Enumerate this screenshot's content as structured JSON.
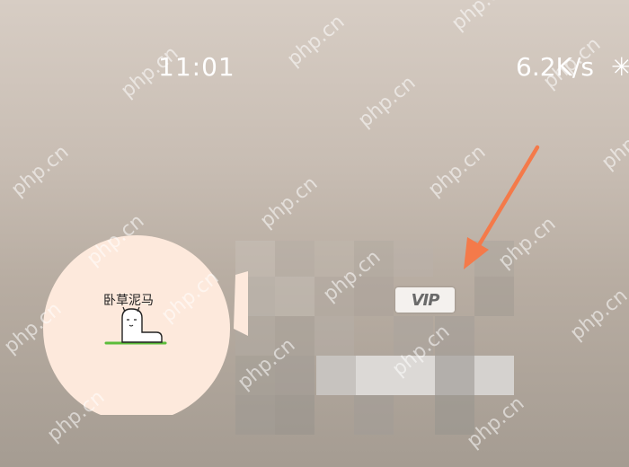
{
  "status_bar": {
    "time": "11:01",
    "network_speed": "6.2K/s",
    "partial_icon": "✳"
  },
  "avatar": {
    "caption": "卧草泥马",
    "icon": "cartoon-sticker-icon"
  },
  "badge": {
    "label": "VIP"
  },
  "annotation": {
    "icon": "arrow-icon",
    "color": "#f47a4a"
  },
  "watermark": {
    "text": "php.cn"
  },
  "colors": {
    "background_top": "#d7cdc4",
    "background_bottom": "#a59c92",
    "avatar_bg": "#fde9dc"
  }
}
